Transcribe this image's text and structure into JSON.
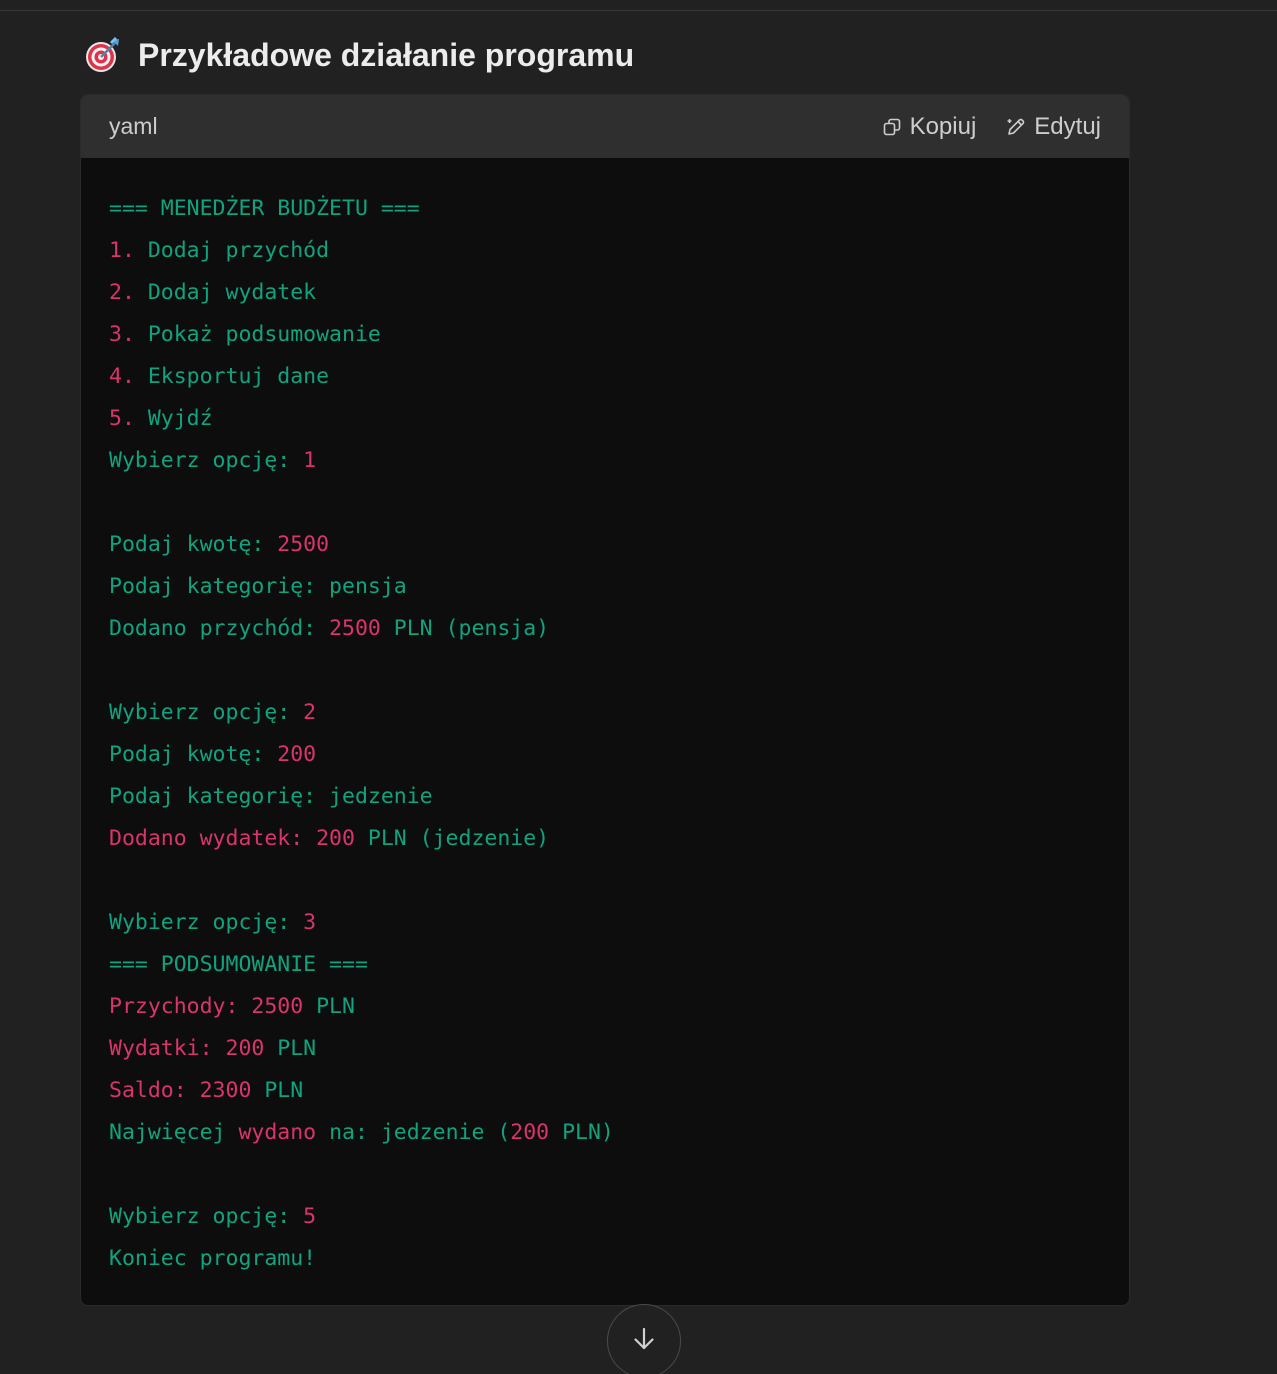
{
  "section": {
    "emoji_icon": "direct-hit-target-icon",
    "title": "Przykładowe działanie programu"
  },
  "codeblock": {
    "language": "yaml",
    "copy_label": "Kopiuj",
    "edit_label": "Edytuj",
    "lines": [
      [
        {
          "t": "=== MENEDŻER BUDŻETU ===",
          "c": "g"
        }
      ],
      [
        {
          "t": "1. ",
          "c": "p"
        },
        {
          "t": "Dodaj przychód",
          "c": "g"
        }
      ],
      [
        {
          "t": "2. ",
          "c": "p"
        },
        {
          "t": "Dodaj wydatek",
          "c": "g"
        }
      ],
      [
        {
          "t": "3. ",
          "c": "p"
        },
        {
          "t": "Pokaż podsumowanie",
          "c": "g"
        }
      ],
      [
        {
          "t": "4. ",
          "c": "p"
        },
        {
          "t": "Eksportuj dane",
          "c": "g"
        }
      ],
      [
        {
          "t": "5. ",
          "c": "p"
        },
        {
          "t": "Wyjdź",
          "c": "g"
        }
      ],
      [
        {
          "t": "Wybierz opcję: ",
          "c": "g"
        },
        {
          "t": "1",
          "c": "p"
        }
      ],
      [],
      [
        {
          "t": "Podaj kwotę: ",
          "c": "g"
        },
        {
          "t": "2500",
          "c": "p"
        }
      ],
      [
        {
          "t": "Podaj kategorię: pensja",
          "c": "g"
        }
      ],
      [
        {
          "t": "Dodano przychód: ",
          "c": "g"
        },
        {
          "t": "2500",
          "c": "p"
        },
        {
          "t": " PLN (pensja)",
          "c": "g"
        }
      ],
      [],
      [
        {
          "t": "Wybierz opcję: ",
          "c": "g"
        },
        {
          "t": "2",
          "c": "p"
        }
      ],
      [
        {
          "t": "Podaj kwotę: ",
          "c": "g"
        },
        {
          "t": "200",
          "c": "p"
        }
      ],
      [
        {
          "t": "Podaj kategorię: jedzenie",
          "c": "g"
        }
      ],
      [
        {
          "t": "Dodano wydatek: ",
          "c": "p"
        },
        {
          "t": "200",
          "c": "p"
        },
        {
          "t": " PLN (jedzenie)",
          "c": "g"
        }
      ],
      [],
      [
        {
          "t": "Wybierz opcję: ",
          "c": "g"
        },
        {
          "t": "3",
          "c": "p"
        }
      ],
      [
        {
          "t": "=== PODSUMOWANIE ===",
          "c": "g"
        }
      ],
      [
        {
          "t": "Przychody: ",
          "c": "p"
        },
        {
          "t": "2500",
          "c": "p"
        },
        {
          "t": " PLN",
          "c": "g"
        }
      ],
      [
        {
          "t": "Wydatki: ",
          "c": "p"
        },
        {
          "t": "200",
          "c": "p"
        },
        {
          "t": " PLN",
          "c": "g"
        }
      ],
      [
        {
          "t": "Saldo: ",
          "c": "p"
        },
        {
          "t": "2300",
          "c": "p"
        },
        {
          "t": " PLN",
          "c": "g"
        }
      ],
      [
        {
          "t": "Najwięcej ",
          "c": "g"
        },
        {
          "t": "wydano",
          "c": "p"
        },
        {
          "t": " na: jedzenie (",
          "c": "g"
        },
        {
          "t": "200",
          "c": "p"
        },
        {
          "t": " PLN)",
          "c": "g"
        }
      ],
      [],
      [
        {
          "t": "Wybierz opcję: ",
          "c": "g"
        },
        {
          "t": "5",
          "c": "p"
        }
      ],
      [
        {
          "t": "Koniec programu!",
          "c": "g"
        }
      ]
    ]
  },
  "scroll_button": {
    "icon": "arrow-down-icon"
  },
  "colors": {
    "background": "#212121",
    "code_background": "#0d0d0d",
    "code_header": "#2f2f2f",
    "green": "#10a37f",
    "pink": "#d9346e"
  }
}
